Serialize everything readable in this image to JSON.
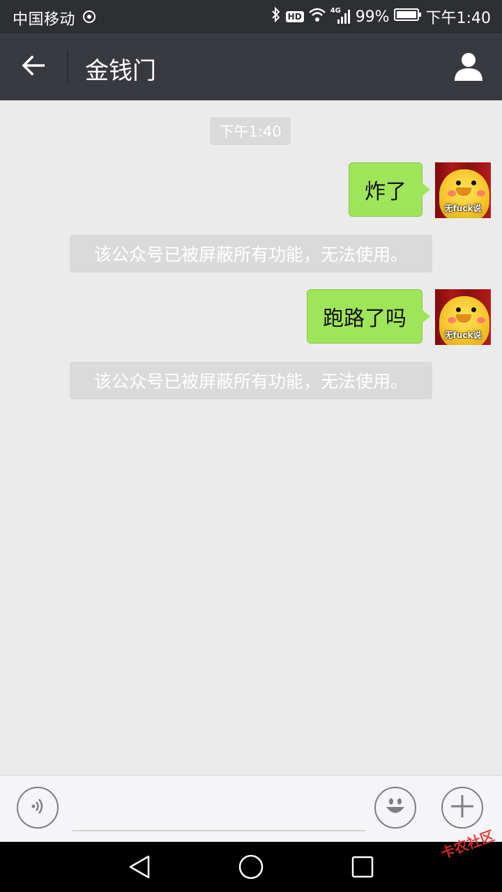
{
  "status_bar": {
    "carrier": "中国移动",
    "hd": "HD",
    "network": "4G",
    "battery": "99%",
    "time": "下午1:40"
  },
  "header": {
    "title": "金钱门"
  },
  "chat": {
    "timestamp": "下午1:40",
    "messages": [
      {
        "text": "炸了",
        "avatar_caption": "无fuck说"
      },
      {
        "notice": "该公众号已被屏蔽所有功能，无法使用。"
      },
      {
        "text": "跑路了吗",
        "avatar_caption": "无fuck说"
      },
      {
        "notice": "该公众号已被屏蔽所有功能，无法使用。"
      }
    ]
  },
  "input": {
    "value": "",
    "placeholder": ""
  },
  "watermark": "卡农社区",
  "icons": [
    "back-arrow-icon",
    "profile-icon",
    "voice-icon",
    "emoji-icon",
    "plus-icon",
    "nav-back-icon",
    "nav-home-icon",
    "nav-recents-icon"
  ],
  "colors": {
    "app_bar": "#393a3f",
    "bubble_green": "#9fe55a",
    "chat_bg": "#ebebeb",
    "notice_bg": "#dadada"
  }
}
